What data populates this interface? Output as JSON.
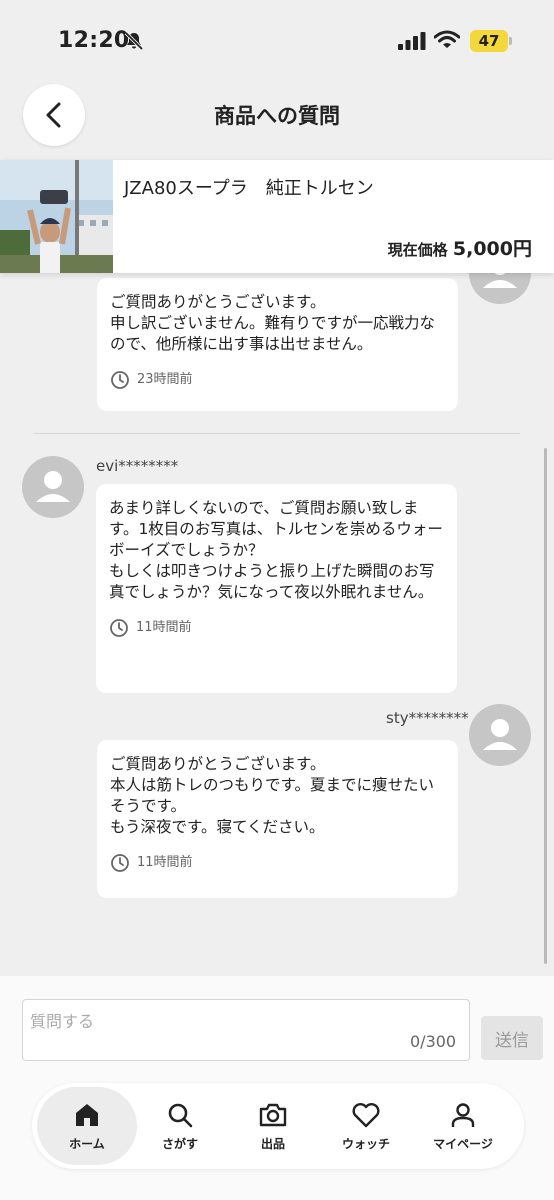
{
  "status_bar": {
    "time": "12:20",
    "battery": "47"
  },
  "header": {
    "title": "商品への質問"
  },
  "product": {
    "name": "JZA80スープラ　純正トルセン",
    "price_label": "現在価格",
    "price": "5,000円"
  },
  "messages": [
    {
      "text": "ご質問ありがとうございます。\n申し訳ございません。難有りですが一応戦力なので、他所様に出す事は出せません。",
      "time": "23時間前"
    },
    {
      "user": "evi********",
      "text": "あまり詳しくないので、ご質問お願い致します。1枚目のお写真は、トルセンを崇めるウォーボーイズでしょうか？\nもしくは叩きつけようと振り上げた瞬間のお写真でしょうか？気になって夜以外眠れません。",
      "time": "11時間前"
    },
    {
      "user": "sty********",
      "text": "ご質問ありがとうございます。\n本人は筋トレのつもりです。夏までに痩せたいそうです。\nもう深夜です。寝てください。",
      "time": "11時間前"
    }
  ],
  "compose": {
    "placeholder": "質問する",
    "counter": "0/300",
    "send_label": "送信"
  },
  "tabs": [
    {
      "label": "ホーム",
      "icon": "home-icon"
    },
    {
      "label": "さがす",
      "icon": "search-icon"
    },
    {
      "label": "出品",
      "icon": "camera-icon"
    },
    {
      "label": "ウォッチ",
      "icon": "heart-icon"
    },
    {
      "label": "マイページ",
      "icon": "user-icon"
    }
  ],
  "colors": {
    "battery": "#f4d73b",
    "background": "#efefef"
  }
}
